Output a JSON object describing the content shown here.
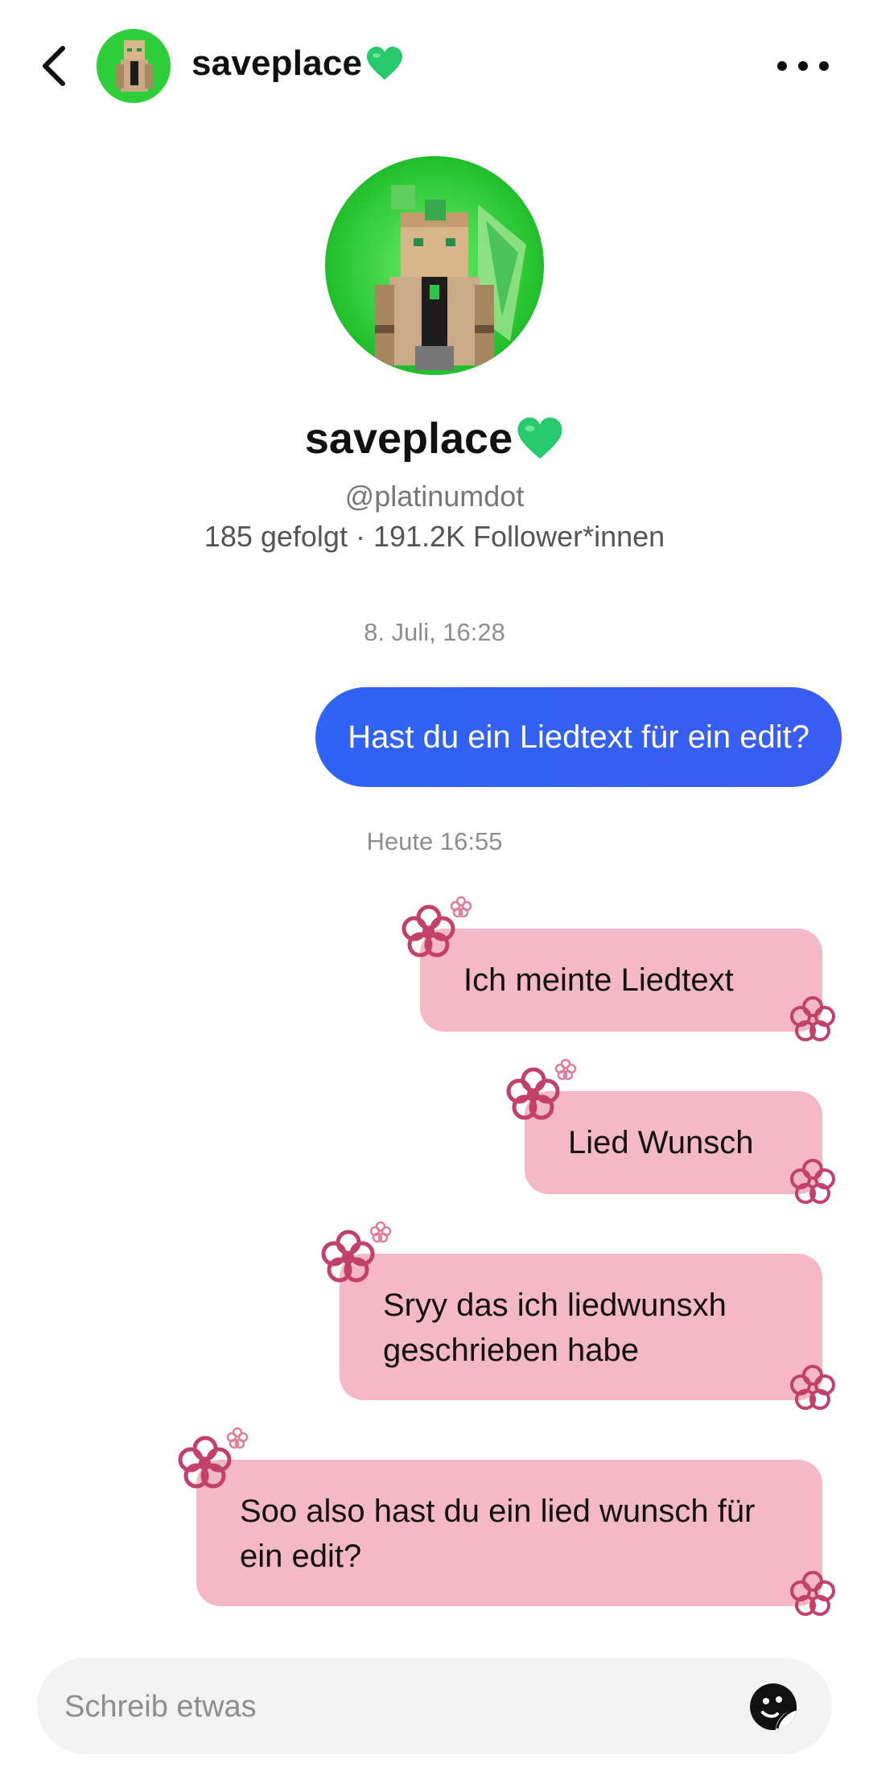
{
  "header": {
    "name": "saveplace",
    "heart_icon": "green-heart-emoji",
    "avatar_icon": "minecraft-skin-avatar"
  },
  "profile": {
    "name": "saveplace",
    "handle": "@platinumdot",
    "stats": "185 gefolgt · 191.2K Follower*innen"
  },
  "messages": {
    "timestamp_1": "8. Juli, 16:28",
    "outgoing_1": "Hast du ein Liedtext für ein edit?",
    "timestamp_2": "Heute 16:55",
    "incoming": [
      {
        "text": "Ich meinte Liedtext"
      },
      {
        "text": "Lied Wunsch"
      },
      {
        "text": "Sryy das ich liedwunsxh geschrieben habe"
      },
      {
        "text": "Soo also hast du ein lied wunsch für ein edit?"
      }
    ]
  },
  "composer": {
    "placeholder": "Schreib etwas",
    "sticker_icon": "sticker-icon"
  },
  "colors": {
    "outgoing_bubble": "#3360f4",
    "incoming_bubble": "#f5b8c7",
    "flower": "#c2406a",
    "accent_green": "#26c96b"
  }
}
